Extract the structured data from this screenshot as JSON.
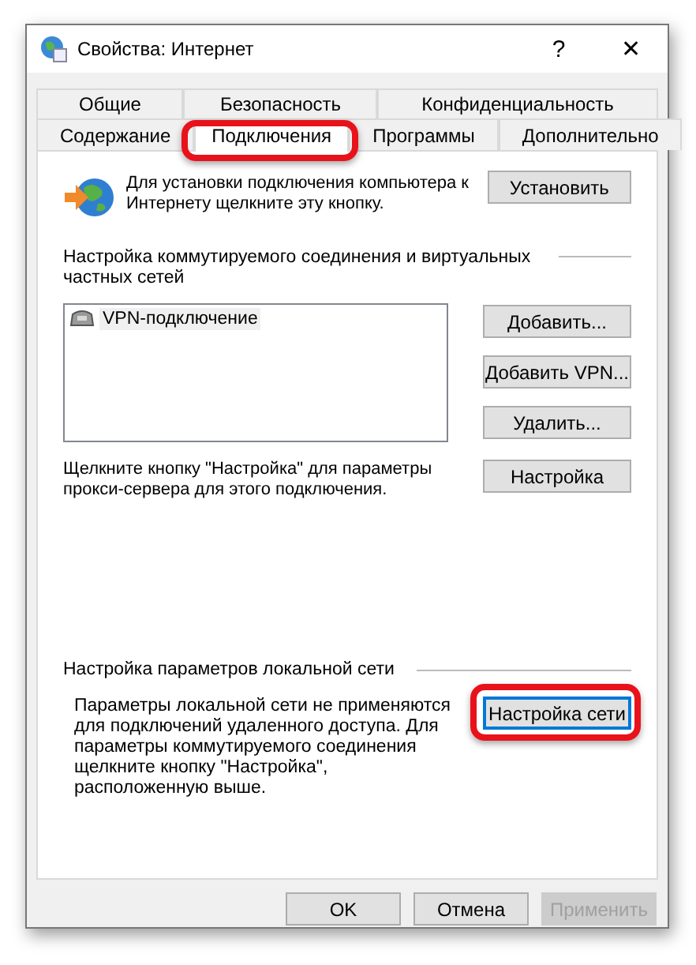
{
  "window": {
    "title": "Свойства: Интернет",
    "help": "?",
    "close": "✕"
  },
  "tab_rows": [
    {
      "tabs": [
        {
          "label": "Общие",
          "selected": false,
          "highlighted": false
        },
        {
          "label": "Безопасность",
          "selected": false,
          "highlighted": false
        },
        {
          "label": "Конфиденциальность",
          "selected": false,
          "highlighted": false
        }
      ]
    },
    {
      "tabs": [
        {
          "label": "Содержание",
          "selected": false,
          "highlighted": false
        },
        {
          "label": "Подключения",
          "selected": true,
          "highlighted": true
        },
        {
          "label": "Программы",
          "selected": false,
          "highlighted": false
        },
        {
          "label": "Дополнительно",
          "selected": false,
          "highlighted": false
        }
      ]
    }
  ],
  "setup": {
    "text": "Для установки подключения компьютера к Интернету щелкните эту кнопку.",
    "button": "Установить"
  },
  "dialup": {
    "heading": "Настройка коммутируемого соединения и виртуальных частных сетей",
    "connections": [
      {
        "name": "VPN-подключение",
        "selected": true
      }
    ],
    "buttons": [
      "Добавить...",
      "Добавить VPN...",
      "Удалить..."
    ],
    "proxy_text": "Щелкните кнопку \"Настройка\" для параметры прокси-сервера для этого подключения.",
    "settings_button": "Настройка"
  },
  "lan": {
    "heading": "Настройка параметров локальной сети",
    "text": "Параметры локальной сети не применяются для подключений удаленного доступа. Для параметры коммутируемого соединения щелкните кнопку \"Настройка\", расположенную выше.",
    "button": {
      "label": "Настройка сети",
      "focused": true,
      "highlighted": true
    }
  },
  "buttons": [
    {
      "label": "OK",
      "disabled": false
    },
    {
      "label": "Отмена",
      "disabled": false
    },
    {
      "label": "Применить",
      "disabled": true
    }
  ]
}
